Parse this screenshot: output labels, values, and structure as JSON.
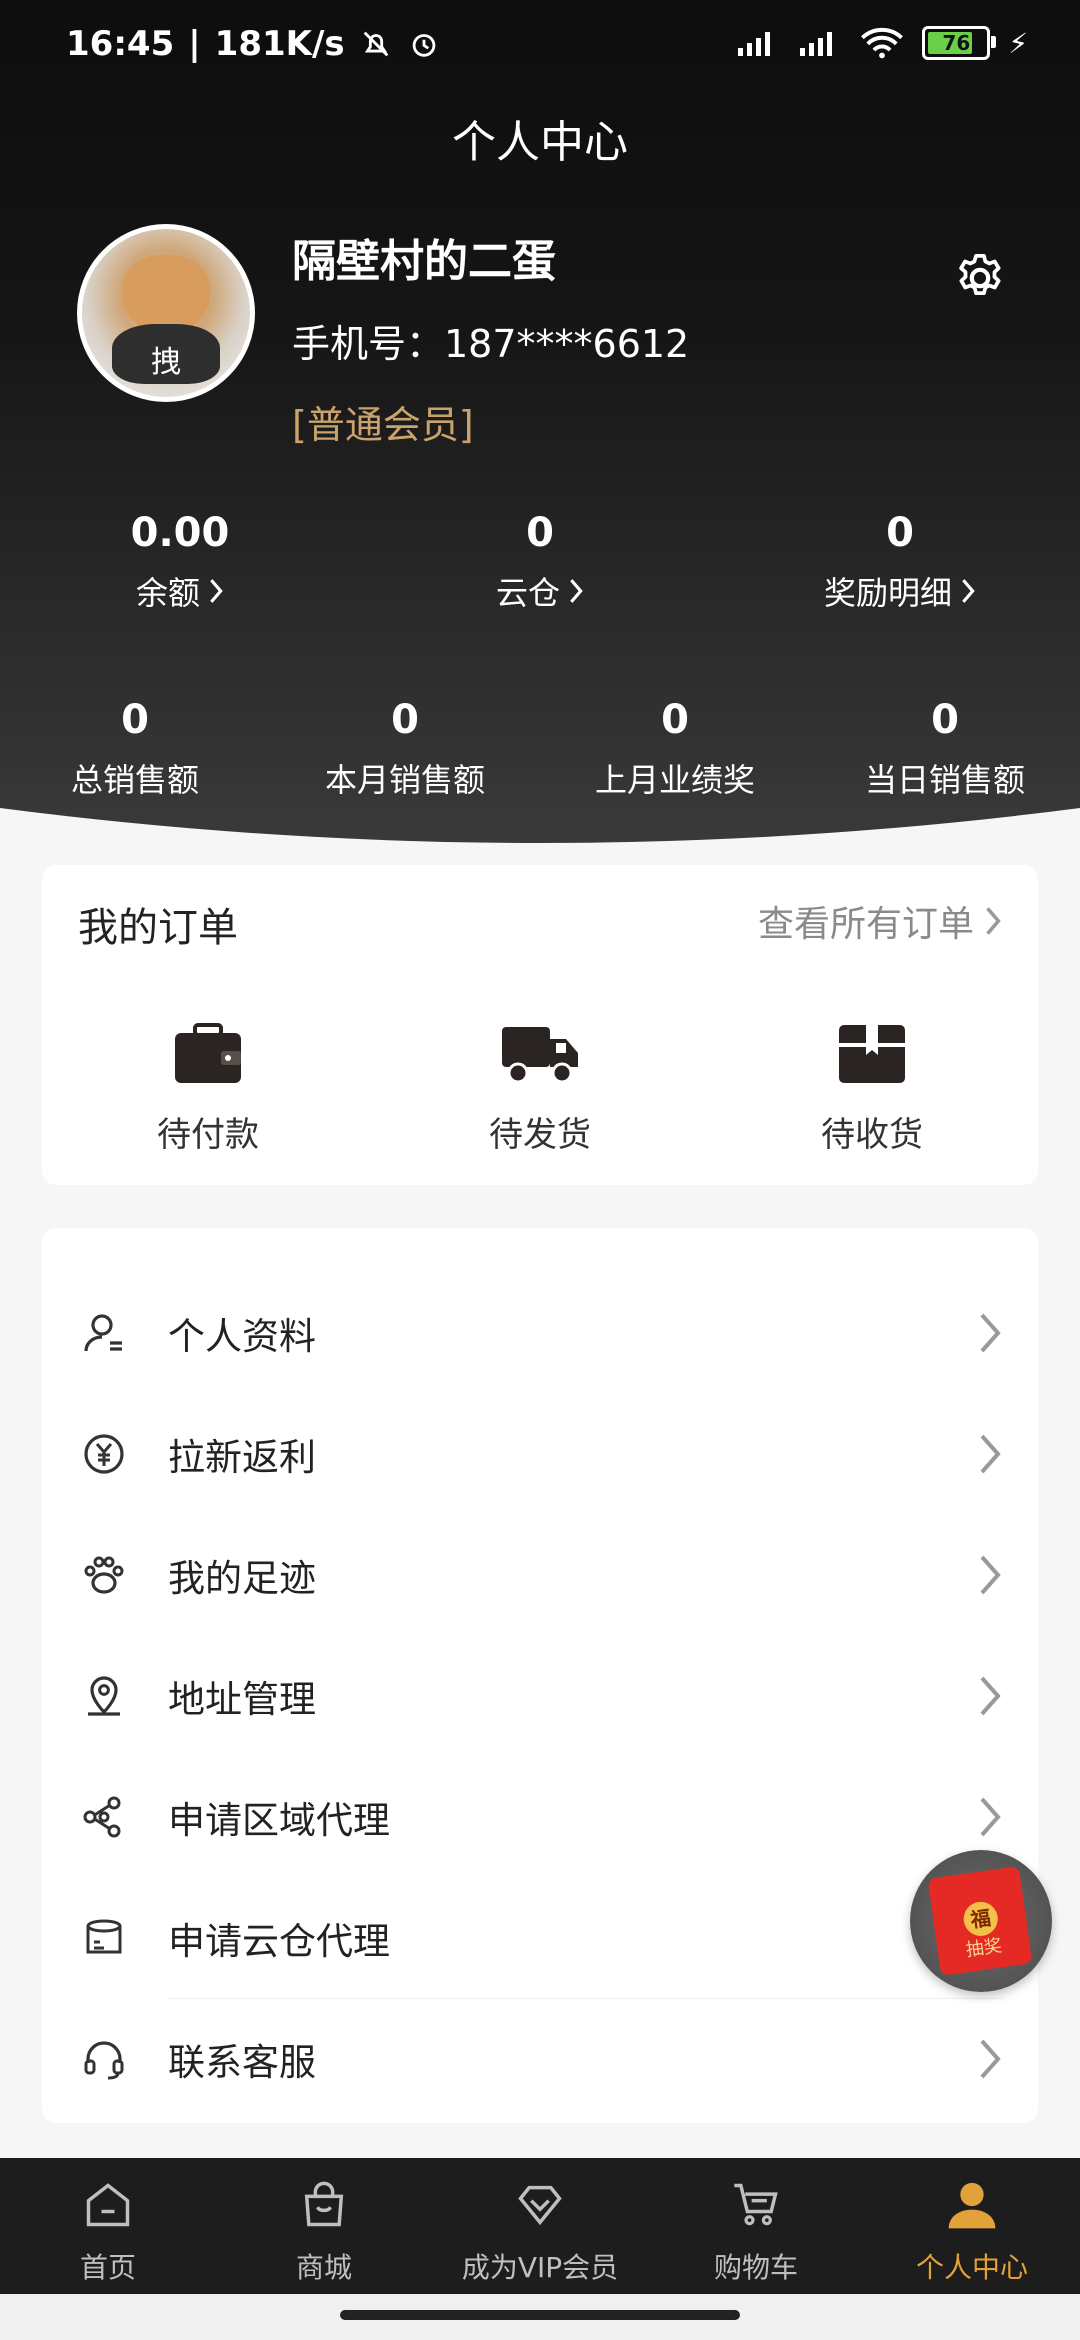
{
  "status_bar": {
    "time": "16:45",
    "net_speed": "181K/s",
    "battery": "76"
  },
  "header": {
    "title": "个人中心"
  },
  "profile": {
    "avatar_watermark": "拽",
    "username": "隔壁村的二蛋",
    "phone_label": "手机号：187****6612",
    "member_level": "[普通会员]"
  },
  "stats_top": [
    {
      "value": "0.00",
      "label": "余额"
    },
    {
      "value": "0",
      "label": "云仓"
    },
    {
      "value": "0",
      "label": "奖励明细"
    }
  ],
  "stats_bottom": [
    {
      "value": "0",
      "label": "总销售额"
    },
    {
      "value": "0",
      "label": "本月销售额"
    },
    {
      "value": "0",
      "label": "上月业绩奖"
    },
    {
      "value": "0",
      "label": "当日销售额"
    }
  ],
  "orders": {
    "title": "我的订单",
    "view_all": "查看所有订单",
    "items": [
      {
        "label": "待付款",
        "icon": "wallet-icon"
      },
      {
        "label": "待发货",
        "icon": "truck-icon"
      },
      {
        "label": "待收货",
        "icon": "package-icon"
      }
    ]
  },
  "menu": [
    {
      "label": "个人资料",
      "icon": "profile-icon"
    },
    {
      "label": "拉新返利",
      "icon": "yuan-coin-icon"
    },
    {
      "label": "我的足迹",
      "icon": "paw-icon"
    },
    {
      "label": "地址管理",
      "icon": "location-pin-icon"
    },
    {
      "label": "申请区域代理",
      "icon": "share-nodes-icon"
    },
    {
      "label": "申请云仓代理",
      "icon": "warehouse-icon"
    },
    {
      "label": "联系客服",
      "icon": "headset-icon"
    }
  ],
  "floating": {
    "seal": "福",
    "text": "抽奖"
  },
  "tabbar": [
    {
      "label": "首页",
      "icon": "home-icon",
      "active": false
    },
    {
      "label": "商城",
      "icon": "shopping-bag-icon",
      "active": false
    },
    {
      "label": "成为VIP会员",
      "icon": "diamond-icon",
      "active": false
    },
    {
      "label": "购物车",
      "icon": "cart-icon",
      "active": false
    },
    {
      "label": "个人中心",
      "icon": "user-icon",
      "active": true
    }
  ],
  "colors": {
    "accent": "#e2a23a",
    "member_gold": "#c9a36b",
    "dark": "#111111"
  }
}
